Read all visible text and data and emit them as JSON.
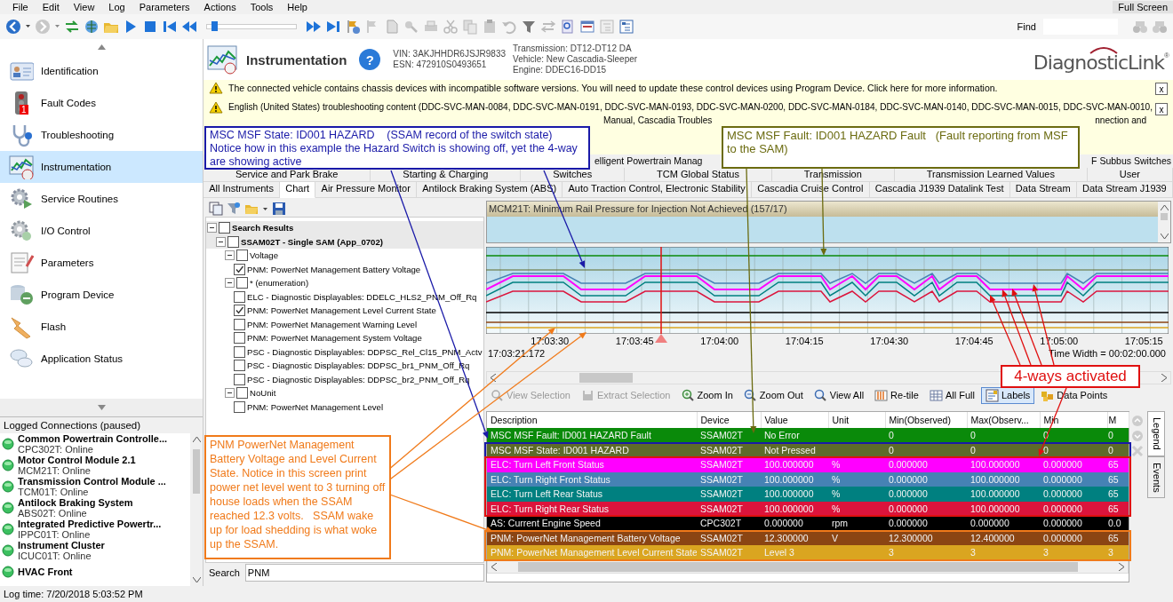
{
  "menu": [
    "File",
    "Edit",
    "View",
    "Log",
    "Parameters",
    "Actions",
    "Tools",
    "Help"
  ],
  "full_screen": "Full Screen",
  "toolbar": {
    "playback_slider": {
      "level": 0.05
    },
    "find_label": "Find"
  },
  "sidebar": {
    "items": [
      {
        "label": "Identification",
        "selected": false
      },
      {
        "label": "Fault Codes",
        "selected": false,
        "badge": "1"
      },
      {
        "label": "Troubleshooting",
        "selected": false
      },
      {
        "label": "Instrumentation",
        "selected": true
      },
      {
        "label": "Service Routines",
        "selected": false
      },
      {
        "label": "I/O Control",
        "selected": false
      },
      {
        "label": "Parameters",
        "selected": false
      },
      {
        "label": "Program Device",
        "selected": false
      },
      {
        "label": "Flash",
        "selected": false
      },
      {
        "label": "Application Status",
        "selected": false
      }
    ]
  },
  "logged_connections": {
    "title": "Logged Connections (paused)",
    "items": [
      {
        "name": "Common Powertrain Controlle...",
        "status": "CPC302T: Online"
      },
      {
        "name": "Motor Control Module 2.1",
        "status": "MCM21T: Online"
      },
      {
        "name": "Transmission Control Module ...",
        "status": "TCM01T: Online"
      },
      {
        "name": "Antilock Braking System",
        "status": "ABS02T: Online"
      },
      {
        "name": "Integrated Predictive Powertr...",
        "status": "IPPC01T: Online"
      },
      {
        "name": "Instrument Cluster",
        "status": "ICUC01T: Online"
      },
      {
        "name": "HVAC Front"
      }
    ]
  },
  "header": {
    "title": "Instrumentation",
    "help": "?",
    "vin": "VIN: 3AKJHHDR6JSJR9833",
    "esn": "ESN: 472910S0493651",
    "transmission": "Transmission: DT12-DT12 DA",
    "vehicle": "Vehicle: New Cascadia-Sleeper",
    "engine": "Engine: DDEC16-DD15",
    "logo": "DiagnosticLink",
    "logo_mark": "®"
  },
  "banners": [
    {
      "lines": [
        "The connected vehicle contains chassis devices with incompatible software versions.  You will need to update these control devices using Program Device. Click here for more information."
      ],
      "close": "x"
    },
    {
      "lines": [
        "English (United States) troubleshooting content (DDC-SVC-MAN-0084, DDC-SVC-MAN-0191, DDC-SVC-MAN-0193, DDC-SVC-MAN-0200, DDC-SVC-MAN-0184, DDC-SVC-MAN-0140, DDC-SVC-MAN-0015, DDC-SVC-MAN-0010,"
      ],
      "fragments": [
        "Manual, Cascadia Troubles",
        "nnection and"
      ],
      "close": "x"
    }
  ],
  "tab_rows": [
    [
      {
        "label": "elligent Powertrain Manag",
        "selected": false
      },
      {
        "label": "F Subbus Switches",
        "selected": false
      }
    ],
    [
      {
        "label": "Service and Park Brake",
        "selected": false
      },
      {
        "label": "Starting & Charging",
        "selected": false
      },
      {
        "label": "Switches",
        "selected": false
      },
      {
        "label": "TCM Global Status",
        "selected": false
      },
      {
        "label": "Transmission",
        "selected": false
      },
      {
        "label": "Transmission Learned Values",
        "selected": false
      },
      {
        "label": "User",
        "selected": false
      }
    ],
    [
      {
        "label": "All Instruments",
        "selected": false
      },
      {
        "label": "Chart",
        "selected": true
      },
      {
        "label": "Air Pressure Monitor",
        "selected": false
      },
      {
        "label": "Antilock Braking System (ABS)",
        "selected": false
      },
      {
        "label": "Auto Traction Control, Electronic Stability",
        "selected": false
      },
      {
        "label": "Cascadia Cruise Control",
        "selected": false
      },
      {
        "label": "Cascadia J1939 Datalink Test",
        "selected": false
      },
      {
        "label": "Data Stream",
        "selected": false
      },
      {
        "label": "Data Stream J1939",
        "selected": false
      }
    ]
  ],
  "left_panel": {
    "tree": [
      {
        "label": "Search Results",
        "checked": false,
        "expanded": true,
        "children": [
          {
            "label": "SSAM02T - Single SAM (App_0702)",
            "checked": false,
            "expanded": true,
            "children": [
              {
                "label": "Voltage",
                "checked": false,
                "expanded": true,
                "children": [
                  {
                    "label": "PNM: PowerNet Management Battery Voltage",
                    "checked": true
                  }
                ]
              },
              {
                "label": "* (enumeration)",
                "checked": false,
                "expanded": true,
                "children": [
                  {
                    "label": "ELC - Diagnostic Displayables: DDELC_HLS2_PNM_Off_Rq",
                    "checked": false
                  },
                  {
                    "label": "PNM: PowerNet Management Level Current State",
                    "checked": true
                  },
                  {
                    "label": "PNM: PowerNet Management Warning Level",
                    "checked": false
                  },
                  {
                    "label": "PNM: PowerNet Management System Voltage",
                    "checked": false
                  },
                  {
                    "label": "PSC - Diagnostic Displayables: DDPSC_Rel_Cl15_PNM_Actv",
                    "checked": false
                  },
                  {
                    "label": "PSC - Diagnostic Displayables: DDPSC_br1_PNM_Off_Rq",
                    "checked": false
                  },
                  {
                    "label": "PSC - Diagnostic Displayables: DDPSC_br2_PNM_Off_Rq",
                    "checked": false
                  }
                ]
              },
              {
                "label": "NoUnit",
                "checked": false,
                "expanded": true,
                "children": [
                  {
                    "label": "PNM: PowerNet Management Level",
                    "checked": false
                  }
                ]
              }
            ]
          }
        ]
      }
    ],
    "search": {
      "label": "Search",
      "value": "PNM"
    }
  },
  "chart": {
    "alarm": "MCM21T: Minimum Rail Pressure for Injection Not Achieved (157/17)",
    "time_ticks": [
      "17:03:30",
      "17:03:45",
      "17:04:00",
      "17:04:15",
      "17:04:30",
      "17:04:45",
      "17:05:00",
      "17:05:15"
    ],
    "start_time": "17:03:21.172",
    "time_width": "Time Width = 00:02:00.000",
    "tools": [
      {
        "label": "View Selection",
        "disabled": true,
        "selected": false
      },
      {
        "label": "Extract Selection",
        "disabled": true,
        "selected": false
      },
      {
        "label": "Zoom In",
        "disabled": false,
        "selected": false
      },
      {
        "label": "Zoom Out",
        "disabled": false,
        "selected": false
      },
      {
        "label": "View All",
        "disabled": false,
        "selected": false
      },
      {
        "label": "Re-tile",
        "disabled": false,
        "selected": false
      },
      {
        "label": "All Full",
        "disabled": false,
        "selected": false
      },
      {
        "label": "Labels",
        "disabled": false,
        "selected": true
      },
      {
        "label": "Data Points",
        "disabled": false,
        "selected": false
      }
    ]
  },
  "table": {
    "columns": [
      "Description",
      "Device",
      "Value",
      "Unit",
      "Min(Observed)",
      "Max(Observ...",
      "Min",
      "M"
    ],
    "row_groups": [
      {
        "rows": [
          {
            "cells": [
              "MSC MSF Fault: ID001 HAZARD Fault",
              "SSAM02T",
              "No Error",
              "",
              "0",
              "0",
              "0",
              "0"
            ],
            "color": "#0a8a0a"
          }
        ]
      },
      {
        "color": "#1a1aa8",
        "rows": [
          {
            "cells": [
              "MSC MSF State: ID001 HAZARD",
              "SSAM02T",
              "Not Pressed",
              "",
              "0",
              "0",
              "0",
              "0"
            ],
            "color": "#5e6b2a"
          }
        ]
      },
      {
        "color": "#e01010",
        "rows": [
          {
            "cells": [
              "ELC: Turn Left Front Status",
              "SSAM02T",
              "100.000000",
              "%",
              "0.000000",
              "100.000000",
              "0.000000",
              "65"
            ],
            "color": "#ff00ff"
          },
          {
            "cells": [
              "ELC: Turn Right Front Status",
              "SSAM02T",
              "100.000000",
              "%",
              "0.000000",
              "100.000000",
              "0.000000",
              "65"
            ],
            "color": "#4682b4"
          },
          {
            "cells": [
              "ELC: Turn Left Rear Status",
              "SSAM02T",
              "100.000000",
              "%",
              "0.000000",
              "100.000000",
              "0.000000",
              "65"
            ],
            "color": "#008080"
          },
          {
            "cells": [
              "ELC: Turn Right Rear Status",
              "SSAM02T",
              "100.000000",
              "%",
              "0.000000",
              "100.000000",
              "0.000000",
              "65"
            ],
            "color": "#dc143c"
          }
        ]
      },
      {
        "rows": [
          {
            "cells": [
              "AS: Current Engine Speed",
              "CPC302T",
              "0.000000",
              "rpm",
              "0.000000",
              "0.000000",
              "0.000000",
              "0.0"
            ],
            "color": "#000000"
          }
        ]
      },
      {
        "color": "#f07a1a",
        "rows": [
          {
            "cells": [
              "PNM: PowerNet Management Battery Voltage",
              "SSAM02T",
              "12.300000",
              "V",
              "12.300000",
              "12.400000",
              "0.000000",
              "65"
            ],
            "color": "#8b4513"
          },
          {
            "cells": [
              "PNM: PowerNet Management Level Current State",
              "SSAM02T",
              "Level 3",
              "",
              "3",
              "3",
              "3",
              "3"
            ],
            "color": "#daa520"
          }
        ]
      }
    ]
  },
  "side_tabs": [
    {
      "label": "Legend",
      "selected": true
    },
    {
      "label": "Events",
      "selected": false
    }
  ],
  "callouts": [
    {
      "text": "MSC MSF State: ID001 HAZARD    (SSAM record of the switch state) Notice how in this example the Hazard Switch is showing off, yet the 4-way are showing active",
      "color": "#1a1aa8"
    },
    {
      "text": "MSC MSF Fault: ID001 HAZARD Fault   (Fault reporting from MSF to the SAM)",
      "color": "#6b6b10"
    },
    {
      "text": "PNM PowerNet Management Battery Voltage and Level Current State. Notice in this screen print power net level went to 3 turning off house loads when the SSAM reached 12.3 volts.   SSAM wake up for load shedding is what woke up the SSAM.",
      "color": "#f07a1a"
    },
    {
      "text": "4-ways activated",
      "color": "#e01010"
    }
  ],
  "status_bar": "Log time: 7/20/2018 5:03:52 PM"
}
